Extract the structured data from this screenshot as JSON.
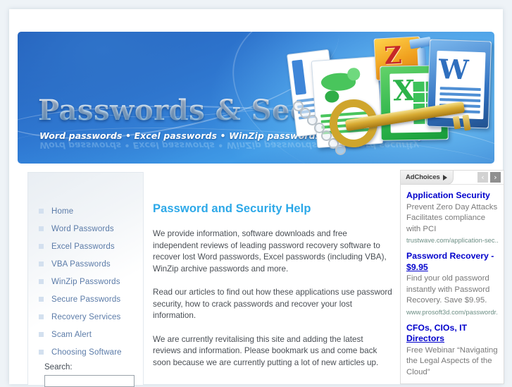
{
  "banner": {
    "title": "Passwords & Security",
    "tagline": "Word passwords • Excel passwords • WinZip passwords • Password security",
    "icons": {
      "word": "W",
      "excel": "X",
      "zip": "Z"
    }
  },
  "sidebar": {
    "items": [
      {
        "label": "Home"
      },
      {
        "label": "Word Passwords"
      },
      {
        "label": "Excel Passwords"
      },
      {
        "label": "VBA Passwords"
      },
      {
        "label": "WinZip Passwords"
      },
      {
        "label": "Secure Passwords"
      },
      {
        "label": "Recovery Services"
      },
      {
        "label": "Scam Alert"
      },
      {
        "label": "Choosing Software"
      }
    ],
    "search": {
      "label": "Search:",
      "value": "",
      "placeholder": ""
    }
  },
  "main": {
    "title": "Password and Security Help",
    "paragraphs": [
      "We provide information, software downloads and free independent reviews of leading password recovery software to recover lost Word passwords, Excel passwords (including VBA), WinZip archive passwords and more.",
      "Read our articles to find out how these applications use password security, how to crack passwords and recover your lost information.",
      "We are currently revitalising this site and adding the latest reviews and information.  Please bookmark us and come back soon because we are currently putting a lot of new articles up."
    ]
  },
  "ads": {
    "header": {
      "adchoices_label": "AdChoices",
      "adchoices_icon": "play-triangle-icon",
      "prev_label": "‹",
      "next_label": "›"
    },
    "items": [
      {
        "title": "Application Security",
        "title_underlined": false,
        "description": "Prevent Zero Day Attacks Facilitates compliance with PCI",
        "url": "trustwave.com/application-sec..."
      },
      {
        "title": "Password Recovery - ",
        "title_suffix": "$9.95",
        "title_underlined": true,
        "description": "Find your old password instantly with Password Recovery. Save $9.95.",
        "url": "www.prosoft3d.com/passwordr..."
      },
      {
        "title": "CFOs, CIOs, IT ",
        "title_suffix": "Directors",
        "title_underlined": true,
        "description": "Free Webinar “Navigating the Legal Aspects of the Cloud”",
        "url": ""
      }
    ]
  },
  "colors": {
    "accent_heading": "#2CA8E8",
    "nav_link": "#5B7BA8",
    "ad_title": "#0000CC",
    "banner_blue": "#2F7AD4"
  }
}
